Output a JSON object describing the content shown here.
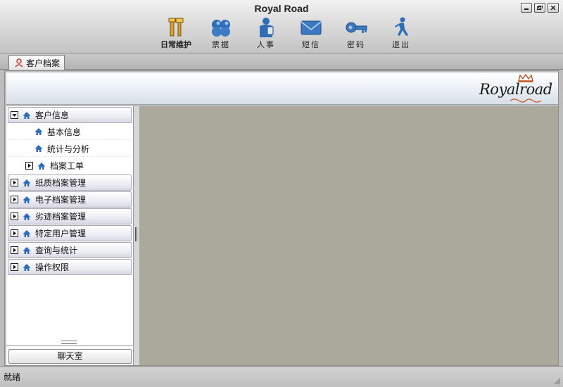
{
  "window": {
    "title": "Royal Road"
  },
  "toolbar": {
    "items": [
      {
        "label": "日常维护",
        "icon": "tools-icon"
      },
      {
        "label": "票据",
        "icon": "clover-icon"
      },
      {
        "label": "人事",
        "icon": "person-icon"
      },
      {
        "label": "短信",
        "icon": "envelope-icon"
      },
      {
        "label": "密码",
        "icon": "key-icon"
      },
      {
        "label": "退出",
        "icon": "walking-person-icon"
      }
    ]
  },
  "tab": {
    "label": "客户档案"
  },
  "banner": {
    "logo_text": "Royalroad"
  },
  "nav": {
    "customer_info": {
      "label": "客户信息"
    },
    "basic_info": {
      "label": "基本信息"
    },
    "stats_analysis": {
      "label": "统计与分析"
    },
    "archive_ticket": {
      "label": "档案工单"
    },
    "paper_archive": {
      "label": "纸质档案管理"
    },
    "e_archive": {
      "label": "电子档案管理"
    },
    "bad_record": {
      "label": "劣迹档案管理"
    },
    "special_users": {
      "label": "特定用户管理"
    },
    "query_stats": {
      "label": "查询与统计"
    },
    "permissions": {
      "label": "操作权限"
    },
    "chat_button": "聊天室"
  },
  "status": {
    "text": "就绪"
  },
  "colors": {
    "content_bg": "#aba89c",
    "icon_blue": "#2e6db8"
  }
}
